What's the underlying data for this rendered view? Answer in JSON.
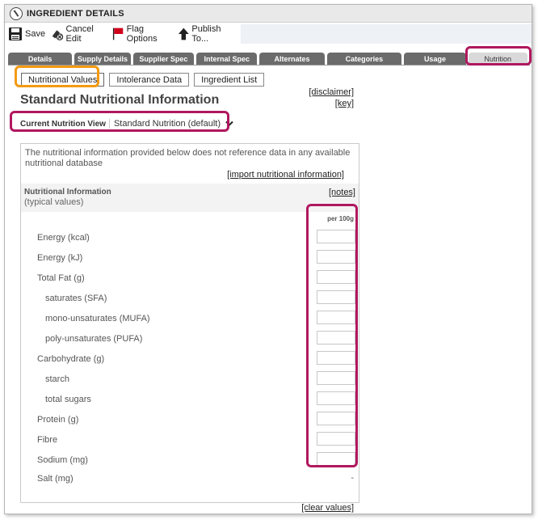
{
  "window": {
    "title": "INGREDIENT DETAILS"
  },
  "toolbar": {
    "save": "Save",
    "cancel_edit": "Cancel Edit",
    "flag_options": "Flag Options",
    "publish_to": "Publish To..."
  },
  "tabs": [
    {
      "label": "Details"
    },
    {
      "label": "Supply Details"
    },
    {
      "label": "Supplier Spec"
    },
    {
      "label": "Internal Spec"
    },
    {
      "label": "Alternates"
    },
    {
      "label": "Categories"
    },
    {
      "label": "Usage"
    },
    {
      "label": "Nutrition"
    }
  ],
  "subtabs": [
    {
      "label": "Nutritional Values"
    },
    {
      "label": "Intolerance Data"
    },
    {
      "label": "Ingredient List"
    }
  ],
  "links": {
    "disclaimer": "[disclaimer]",
    "key": "[key]",
    "import": "[import nutritional information]",
    "notes": "[notes]",
    "clear": "[clear values]"
  },
  "page_title": "Standard Nutritional Information",
  "view": {
    "label": "Current Nutrition View",
    "selected": "Standard Nutrition (default)"
  },
  "panel": {
    "message": "The nutritional information provided below does not reference data in any available nutritional database",
    "ni_title": "Nutritional Information",
    "ni_sub": "(typical values)",
    "per_100g": "per 100g"
  },
  "nutrients": [
    {
      "label": "Energy (kcal)"
    },
    {
      "label": "Energy (kJ)"
    },
    {
      "label": "Total Fat (g)"
    },
    {
      "label": "saturates (SFA)"
    },
    {
      "label": "mono-unsaturates (MUFA)"
    },
    {
      "label": "poly-unsaturates (PUFA)"
    },
    {
      "label": "Carbohydrate (g)"
    },
    {
      "label": "starch"
    },
    {
      "label": "total sugars"
    },
    {
      "label": "Protein (g)"
    },
    {
      "label": "Fibre"
    },
    {
      "label": "Sodium (mg)"
    }
  ],
  "salt": {
    "label": "Salt (mg)",
    "value": "-"
  },
  "colors": {
    "tab_bg": "#6b6b6b",
    "highlight_pink": "#b0185f",
    "highlight_orange": "#f39a12"
  }
}
